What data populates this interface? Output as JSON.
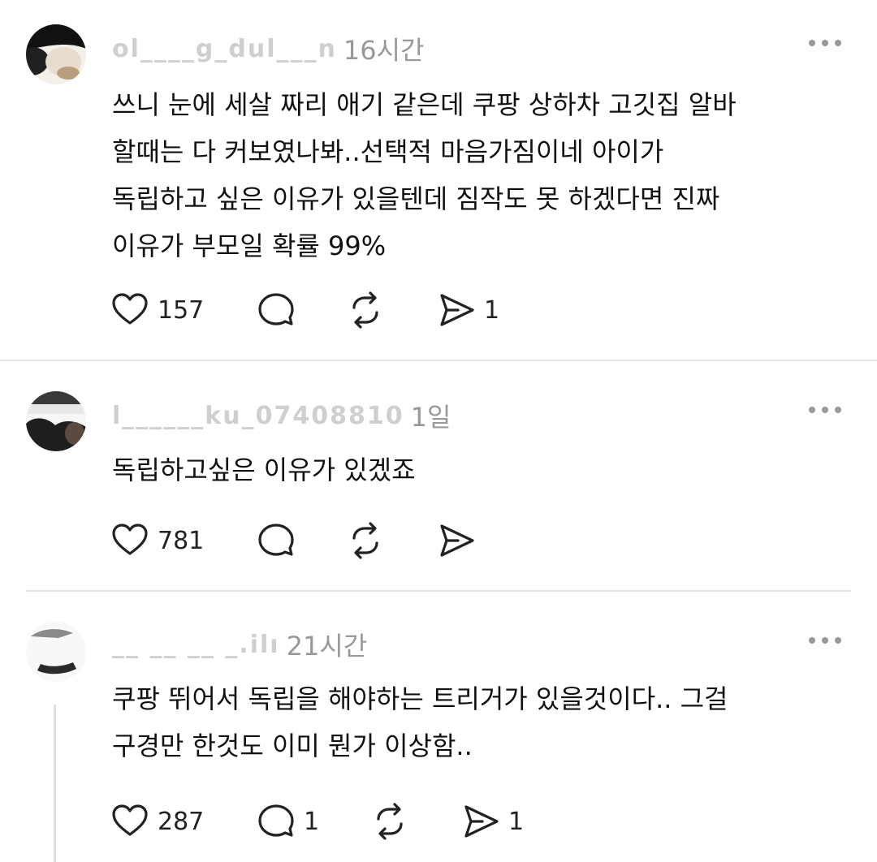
{
  "posts": [
    {
      "username": "ol____g_dul___n",
      "time": "16시간",
      "lines": [
        "쓰니 눈에 세살 짜리 애기 같은데 쿠팡 상하차 고깃집 알바",
        "할때는 다 커보였나봐..선택적 마음가짐이네 아이가",
        "독립하고 싶은 이유가 있을텐데 짐작도 못 하겠다면 진짜",
        "이유가 부모일 확률 99%"
      ],
      "likes": "157",
      "replies": "",
      "reposts": "",
      "shares": "1"
    },
    {
      "username": "l______ku_07408810",
      "time": "1일",
      "lines": [
        "독립하고싶은 이유가 있겠죠"
      ],
      "likes": "781",
      "replies": "",
      "reposts": "",
      "shares": ""
    },
    {
      "username": "__ __ __ _.ilı",
      "time": "21시간",
      "lines": [
        "쿠팡 뛰어서 독립을 해야하는  트리거가 있을것이다.. 그걸",
        "구경만 한것도 이미 뭔가 이상함.."
      ],
      "likes": "287",
      "replies": "1",
      "reposts": "",
      "shares": "1"
    }
  ],
  "icons": {
    "like": "heart-icon",
    "reply": "comment-bubble-icon",
    "repost": "repost-icon",
    "share": "send-icon",
    "more": "more-dots-icon"
  }
}
